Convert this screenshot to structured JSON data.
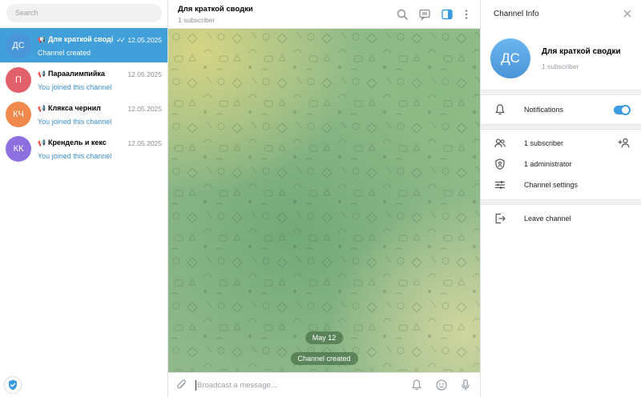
{
  "colors": {
    "accent": "#419fd9",
    "preview_link": "#3a8fcf",
    "toggle_on": "#3a9be0",
    "avatars": [
      "#4a94d8",
      "#e0616b",
      "#ef8a4c",
      "#8d6fe0"
    ]
  },
  "search": {
    "placeholder": "Search"
  },
  "chats": [
    {
      "initials": "ДС",
      "name": "Для краткой своді",
      "date": "12.05.2025",
      "preview": "Channel created",
      "active": true,
      "channel_icon": "megaphone-icon",
      "read_icon": "double-check-icon"
    },
    {
      "initials": "П",
      "name": "Параалимпийка",
      "date": "12.05.2025",
      "preview": "You joined this channel",
      "active": false,
      "channel_icon": "megaphone-icon"
    },
    {
      "initials": "КЧ",
      "name": "Клякса чернил",
      "date": "12.05.2025",
      "preview": "You joined this channel",
      "active": false,
      "channel_icon": "megaphone-icon"
    },
    {
      "initials": "КК",
      "name": "Крендель и кекс",
      "date": "12.05.2025",
      "preview": "You joined this channel",
      "active": false,
      "channel_icon": "megaphone-icon"
    }
  ],
  "header": {
    "title": "Для краткой сводки",
    "subtitle": "1 subscriber",
    "icons": [
      "search-icon",
      "live-stream-icon",
      "sidebar-toggle-icon",
      "more-vertical-icon"
    ]
  },
  "messages": {
    "date_pill": "May 12",
    "service": "Channel created"
  },
  "composer": {
    "placeholder": "Broadcast a message...",
    "icons": [
      "attach-icon",
      "bell-icon",
      "emoji-icon",
      "microphone-icon"
    ]
  },
  "info": {
    "panel_title": "Channel Info",
    "initials": "ДС",
    "name": "Для краткой сводки",
    "subscribers": "1 subscriber",
    "notifications_label": "Notifications",
    "notifications_on": true,
    "subscribers_row": "1 subscriber",
    "administrators_row": "1 administrator",
    "settings_row": "Channel settings",
    "leave_row": "Leave channel"
  }
}
